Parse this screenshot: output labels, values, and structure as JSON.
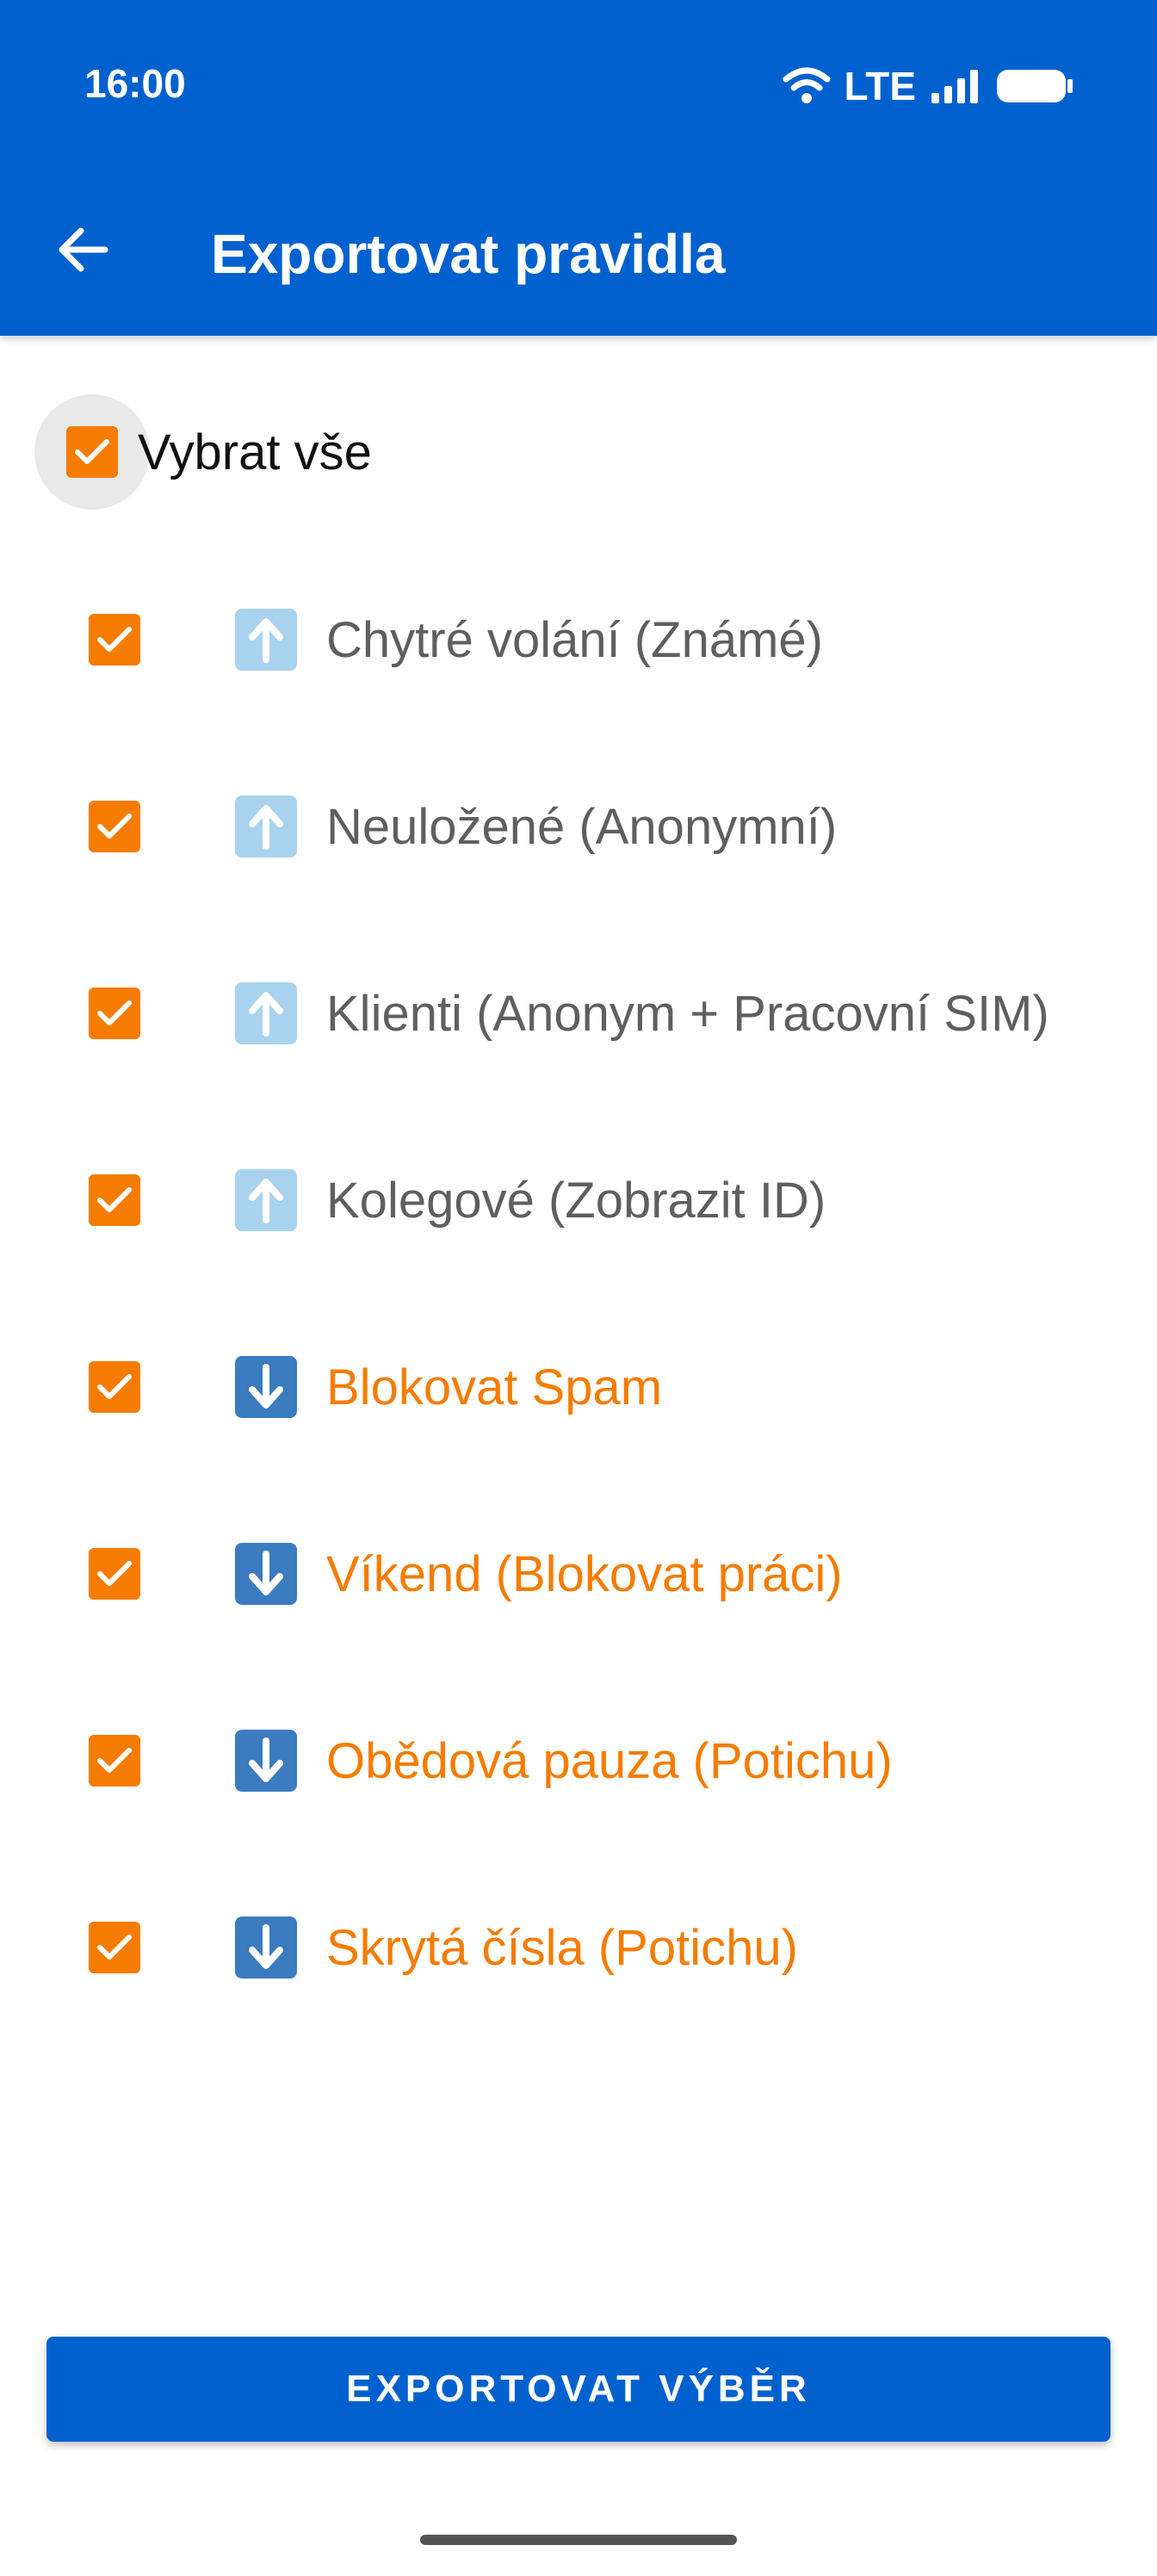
{
  "status_bar": {
    "time": "16:00",
    "network": "LTE"
  },
  "app_bar": {
    "title": "Exportovat pravidla"
  },
  "select_all": {
    "label": "Vybrat vše",
    "checked": true
  },
  "rules": [
    {
      "label": "Chytré volání (Známé)",
      "direction": "up",
      "color": "#5f5f5f",
      "checked": true
    },
    {
      "label": "Neuložené (Anonymní)",
      "direction": "up",
      "color": "#5f5f5f",
      "checked": true
    },
    {
      "label": "Klienti (Anonym + Pracovní SIM)",
      "direction": "up",
      "color": "#5f5f5f",
      "checked": true
    },
    {
      "label": "Kolegové (Zobrazit ID)",
      "direction": "up",
      "color": "#5f5f5f",
      "checked": true
    },
    {
      "label": "Blokovat Spam",
      "direction": "down",
      "color": "#F57C00",
      "checked": true
    },
    {
      "label": "Víkend (Blokovat práci)",
      "direction": "down",
      "color": "#F57C00",
      "checked": true
    },
    {
      "label": "Obědová pauza (Potichu)",
      "direction": "down",
      "color": "#F57C00",
      "checked": true
    },
    {
      "label": "Skrytá čísla (Potichu)",
      "direction": "down",
      "color": "#F57C00",
      "checked": true
    }
  ],
  "export_button": {
    "label": "EXPORTOVAT VÝBĚR"
  },
  "colors": {
    "primary": "#0061CE",
    "accent": "#F57C00"
  }
}
